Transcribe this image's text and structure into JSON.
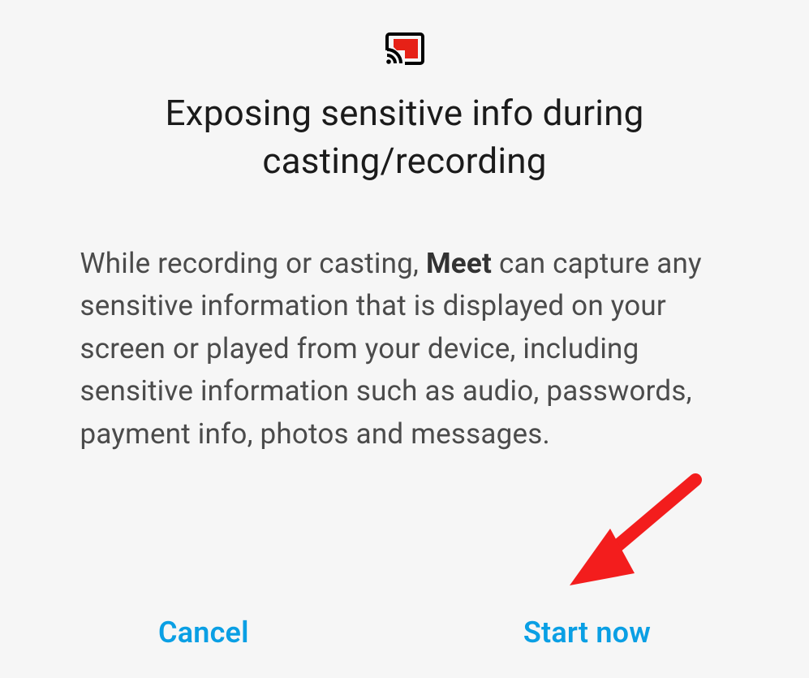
{
  "dialog": {
    "title": "Exposing sensitive info during casting/recording",
    "body_lead": "While recording or casting, ",
    "app_name": "Meet",
    "body_tail": " can capture any sensitive information that is displayed on your screen or played from your device, including sensitive information such as audio, passwords, payment info, photos and messages.",
    "cancel_label": "Cancel",
    "start_label": "Start now"
  }
}
